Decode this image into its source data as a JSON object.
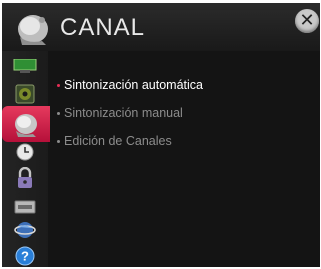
{
  "header": {
    "title": "CANAL",
    "logo_icon": "satellite-dish-icon",
    "close_icon": "close-icon",
    "close_label": "✕"
  },
  "sidebar": {
    "items": [
      {
        "icon": "picture-icon",
        "selected": false
      },
      {
        "icon": "audio-speaker-icon",
        "selected": false
      },
      {
        "icon": "satellite-dish-icon",
        "selected": true
      },
      {
        "icon": "clock-icon",
        "selected": false
      },
      {
        "icon": "lock-icon",
        "selected": false
      },
      {
        "icon": "options-icon",
        "selected": false
      },
      {
        "icon": "network-icon",
        "selected": false
      },
      {
        "icon": "help-icon",
        "selected": false
      }
    ]
  },
  "menu": {
    "items": [
      {
        "label": "Sintonización automática",
        "active": true
      },
      {
        "label": "Sintonización manual",
        "active": false
      },
      {
        "label": "Edición de Canales",
        "active": false
      }
    ]
  },
  "colors": {
    "accent": "#d8194a",
    "background": "#141414",
    "header": "#222222",
    "text_active": "#ffffff",
    "text_inactive": "#8c8c8c"
  }
}
